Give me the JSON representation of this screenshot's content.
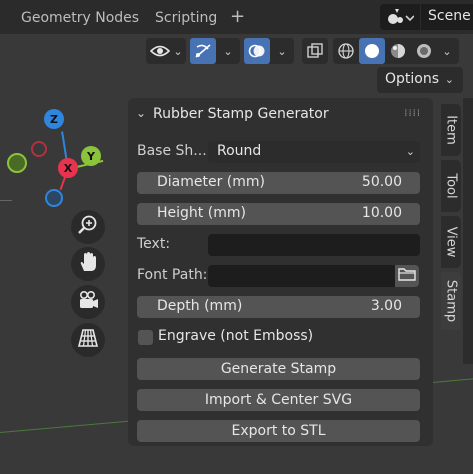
{
  "workspace_tabs": [
    {
      "label": "Geometry Nodes"
    },
    {
      "label": "Scripting"
    }
  ],
  "add_tab_glyph": "+",
  "scene": {
    "label": "Scene"
  },
  "header": {
    "options_label": "Options"
  },
  "gizmo": {
    "z": "Z",
    "x": "X",
    "y": "Y"
  },
  "panel": {
    "title": "Rubber Stamp Generator",
    "base_shape": {
      "label": "Base Sh...",
      "value": "Round"
    },
    "diameter": {
      "label": "Diameter (mm)",
      "value": "50.00"
    },
    "height": {
      "label": "Height (mm)",
      "value": "10.00"
    },
    "text": {
      "label": "Text:",
      "value": ""
    },
    "font_path": {
      "label": "Font Path:",
      "value": ""
    },
    "depth": {
      "label": "Depth (mm)",
      "value": "3.00"
    },
    "engrave": {
      "label": "Engrave (not Emboss)",
      "checked": false
    },
    "generate_label": "Generate Stamp",
    "import_label": "Import & Center SVG",
    "export_label": "Export to STL"
  },
  "side_tabs": [
    {
      "label": "Item",
      "active": false
    },
    {
      "label": "Tool",
      "active": false
    },
    {
      "label": "View",
      "active": false
    },
    {
      "label": "Stamp",
      "active": true
    }
  ],
  "colors": {
    "accent_blue": "#4772b3",
    "axis_x": "#e8334f",
    "axis_y": "#8bc43b",
    "axis_z": "#2e86de"
  }
}
